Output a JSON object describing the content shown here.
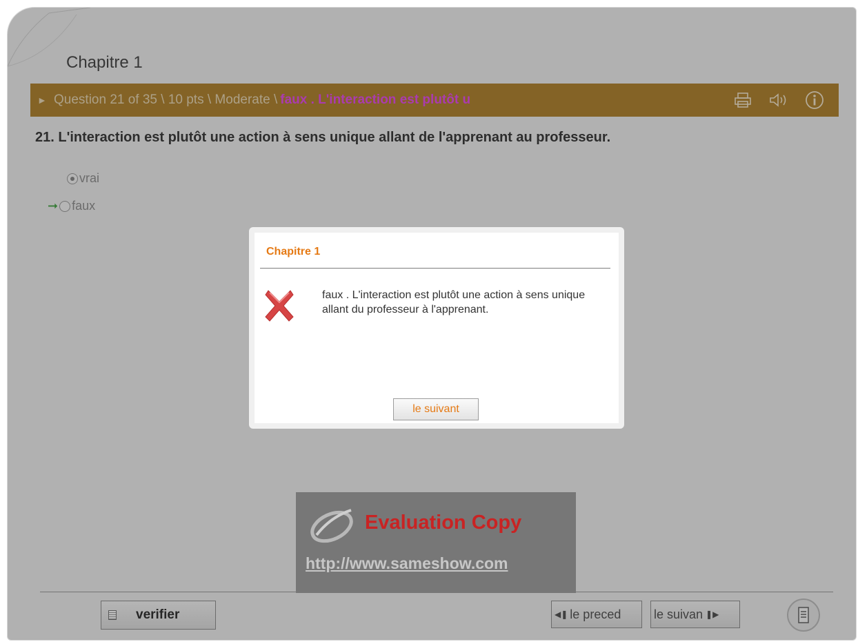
{
  "chapter_title": "Chapitre 1",
  "question_bar": {
    "meta": "Question 21 of 35 \\ 10 pts \\ Moderate \\",
    "feedback_preview": "faux . L'interaction est plutôt u"
  },
  "question": {
    "text": "21. L'interaction est plutôt une action à sens unique allant de l'apprenant au professeur.",
    "options": [
      {
        "label": "vrai",
        "selected": true,
        "correct": false
      },
      {
        "label": "faux",
        "selected": false,
        "correct": true
      }
    ]
  },
  "dialog": {
    "title": "Chapitre 1",
    "message": "faux . L'interaction est plutôt une action à sens unique allant du professeur à l'apprenant.",
    "button_label": "le suivant"
  },
  "watermark": {
    "title": "Evaluation Copy",
    "url": "http://www.sameshow.com"
  },
  "footer": {
    "verify_label": "verifier",
    "prev_label": "le preced",
    "next_label": "le suivan"
  },
  "icons": {
    "print": "printer-icon",
    "audio": "speaker-icon",
    "info": "info-icon",
    "error": "x-error-icon",
    "outline": "outline-icon"
  },
  "colors": {
    "bar": "#b08433",
    "feedback": "#e34fe8",
    "dialog_title": "#e57a15",
    "error": "#d43a3a",
    "watermark_title": "#c92323"
  }
}
